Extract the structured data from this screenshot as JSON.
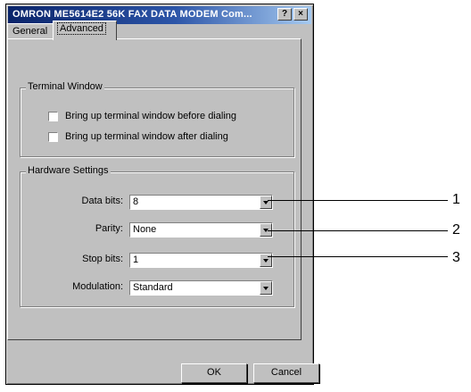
{
  "window": {
    "title": "OMRON ME5614E2 56K FAX DATA MODEM Com...",
    "help_button": "?",
    "close_button": "×"
  },
  "tabs": [
    {
      "label": "General",
      "selected": false
    },
    {
      "label": "Advanced",
      "selected": true
    }
  ],
  "terminal_window": {
    "label": "Terminal Window",
    "checkboxes": [
      {
        "label": "Bring up terminal window before dialing",
        "checked": false
      },
      {
        "label": "Bring up terminal window after dialing",
        "checked": false
      }
    ]
  },
  "hardware_settings": {
    "label": "Hardware Settings",
    "fields": [
      {
        "label": "Data bits:",
        "value": "8"
      },
      {
        "label": "Parity:",
        "value": "None"
      },
      {
        "label": "Stop bits:",
        "value": "1"
      },
      {
        "label": "Modulation:",
        "value": "Standard"
      }
    ]
  },
  "buttons": {
    "ok": "OK",
    "cancel": "Cancel"
  },
  "callouts": [
    "1",
    "2",
    "3"
  ],
  "colors": {
    "dialog_bg": "#c0c0c0",
    "titlebar_start": "#0a246a",
    "titlebar_end": "#a6caf0"
  }
}
